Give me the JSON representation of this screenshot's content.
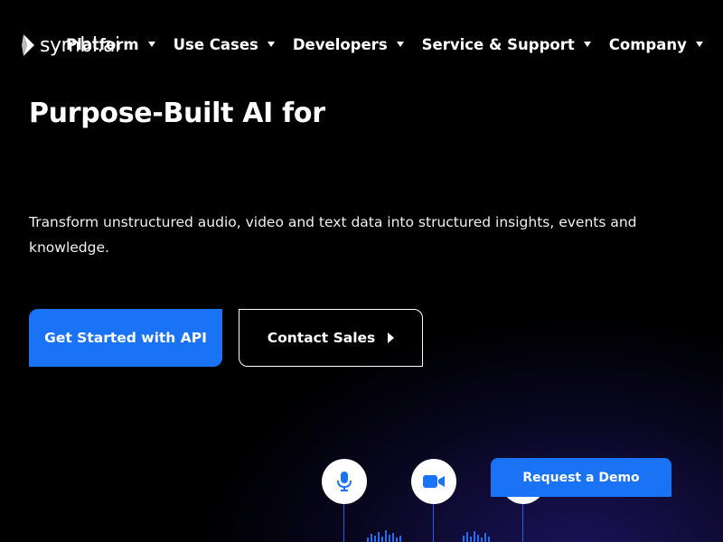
{
  "header": {
    "logo_text": "symbl.ai",
    "nav": [
      {
        "label": "Platform"
      },
      {
        "label": "Use Cases"
      },
      {
        "label": "Developers"
      },
      {
        "label": "Service & Support"
      },
      {
        "label": "Company"
      }
    ]
  },
  "hero": {
    "title": "Purpose-Built AI for",
    "subtitle": "Transform unstructured audio, video and text data into structured insights, events and knowledge.",
    "primary_button": "Get Started with API",
    "secondary_button": "Contact Sales"
  },
  "floating": {
    "demo_button": "Request a Demo"
  },
  "illustration": {
    "icons": [
      "microphone-icon",
      "video-camera-icon",
      "text-icon"
    ]
  },
  "colors": {
    "accent": "#1a73f5",
    "background": "#000000",
    "glow": "#281e8c"
  }
}
